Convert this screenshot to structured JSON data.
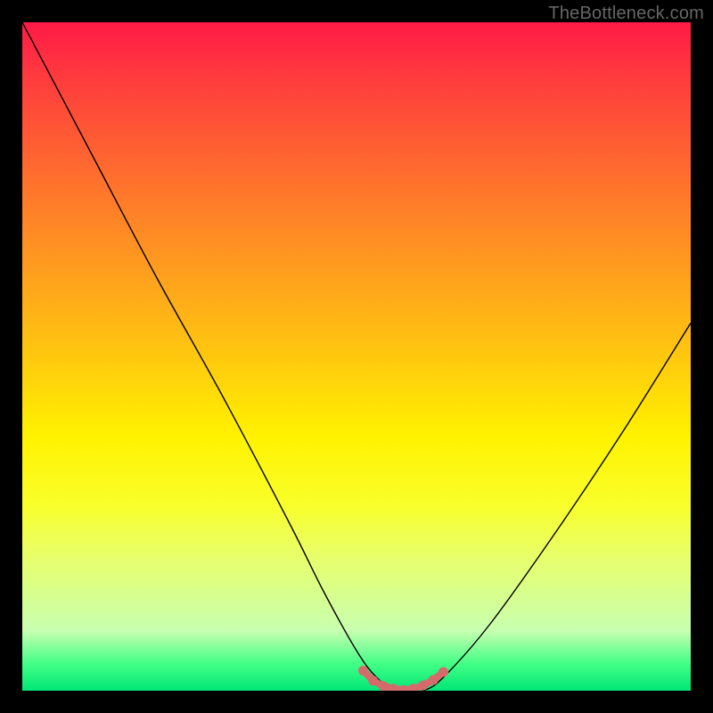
{
  "watermark": "TheBottleneck.com",
  "chart_data": {
    "type": "line",
    "title": "",
    "xlabel": "",
    "ylabel": "",
    "xlim": [
      0,
      100
    ],
    "ylim": [
      0,
      100
    ],
    "grid": false,
    "background_gradient": {
      "top": "#ff1a47",
      "mid": "#fff200",
      "bottom": "#00e676"
    },
    "series": [
      {
        "name": "bottleneck-curve",
        "x": [
          0,
          10,
          20,
          30,
          40,
          45,
          50,
          53,
          56,
          58,
          60,
          63,
          70,
          80,
          90,
          100
        ],
        "y": [
          100,
          81,
          62,
          44,
          25,
          15,
          6,
          2,
          0,
          0,
          0,
          2,
          10,
          24,
          39,
          55
        ]
      }
    ],
    "highlight": {
      "name": "optimal-range",
      "color": "#d66a6a",
      "x": [
        51,
        52.5,
        54,
        55.5,
        57,
        58.5,
        60,
        61.5,
        63
      ],
      "y": [
        3,
        1.5,
        0.7,
        0.3,
        0.1,
        0.3,
        0.8,
        1.6,
        2.8
      ]
    }
  }
}
